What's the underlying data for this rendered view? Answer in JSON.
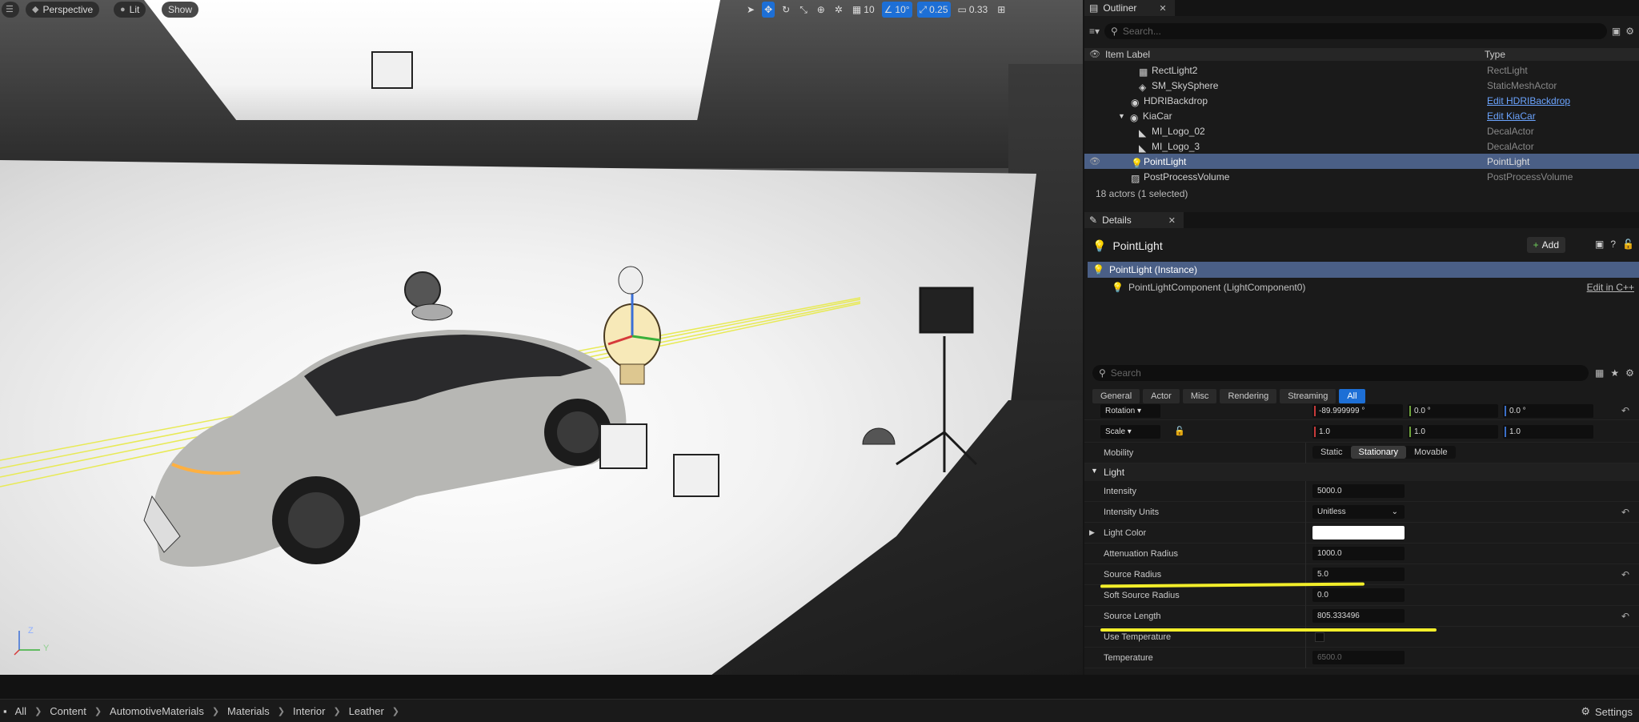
{
  "viewport": {
    "perspective_label": "Perspective",
    "lit_label": "Lit",
    "show_label": "Show",
    "grid_value": "10",
    "angle_value": "10°",
    "scale_value": "0.25",
    "camera_speed": "0.33",
    "gizmo_z": "Z",
    "gizmo_y": "Y"
  },
  "outliner": {
    "tab_label": "Outliner",
    "search_placeholder": "Search...",
    "col_label": "Item Label",
    "col_type": "Type",
    "rows": [
      {
        "label": "RectLight2",
        "type": "RectLight"
      },
      {
        "label": "SM_SkySphere",
        "type": "StaticMeshActor"
      },
      {
        "label": "HDRIBackdrop",
        "type": "Edit HDRIBackdrop"
      },
      {
        "label": "KiaCar",
        "type": "Edit KiaCar"
      },
      {
        "label": "MI_Logo_02",
        "type": "DecalActor"
      },
      {
        "label": "MI_Logo_3",
        "type": "DecalActor"
      },
      {
        "label": "PointLight",
        "type": "PointLight"
      },
      {
        "label": "PostProcessVolume",
        "type": "PostProcessVolume"
      }
    ],
    "status": "18 actors (1 selected)"
  },
  "details": {
    "tab_label": "Details",
    "actor_name": "PointLight",
    "add_label": "Add",
    "instance_label": "PointLight (Instance)",
    "component_label": "PointLightComponent (LightComponent0)",
    "edit_cpp": "Edit in C++",
    "search_placeholder": "Search",
    "filters": [
      "General",
      "Actor",
      "Misc",
      "Rendering",
      "Streaming",
      "All"
    ],
    "rotation_label": "Rotation",
    "rotation": [
      "-89.999999 °",
      "0.0 °",
      "0.0 °"
    ],
    "scale_label": "Scale",
    "scale": [
      "1.0",
      "1.0",
      "1.0"
    ],
    "mobility_label": "Mobility",
    "mobility_options": [
      "Static",
      "Stationary",
      "Movable"
    ],
    "light_section": "Light",
    "intensity_label": "Intensity",
    "intensity": "5000.0",
    "intensity_units_label": "Intensity Units",
    "intensity_units": "Unitless",
    "light_color_label": "Light Color",
    "attenuation_label": "Attenuation Radius",
    "attenuation": "1000.0",
    "source_radius_label": "Source Radius",
    "source_radius": "5.0",
    "soft_source_label": "Soft Source Radius",
    "soft_source": "0.0",
    "source_length_label": "Source Length",
    "source_length": "805.333496",
    "use_temp_label": "Use Temperature",
    "temperature_label": "Temperature",
    "temperature": "6500.0"
  },
  "bottom": {
    "crumbs": [
      "All",
      "Content",
      "AutomotiveMaterials",
      "Materials",
      "Interior",
      "Leather"
    ],
    "settings_label": "Settings"
  }
}
